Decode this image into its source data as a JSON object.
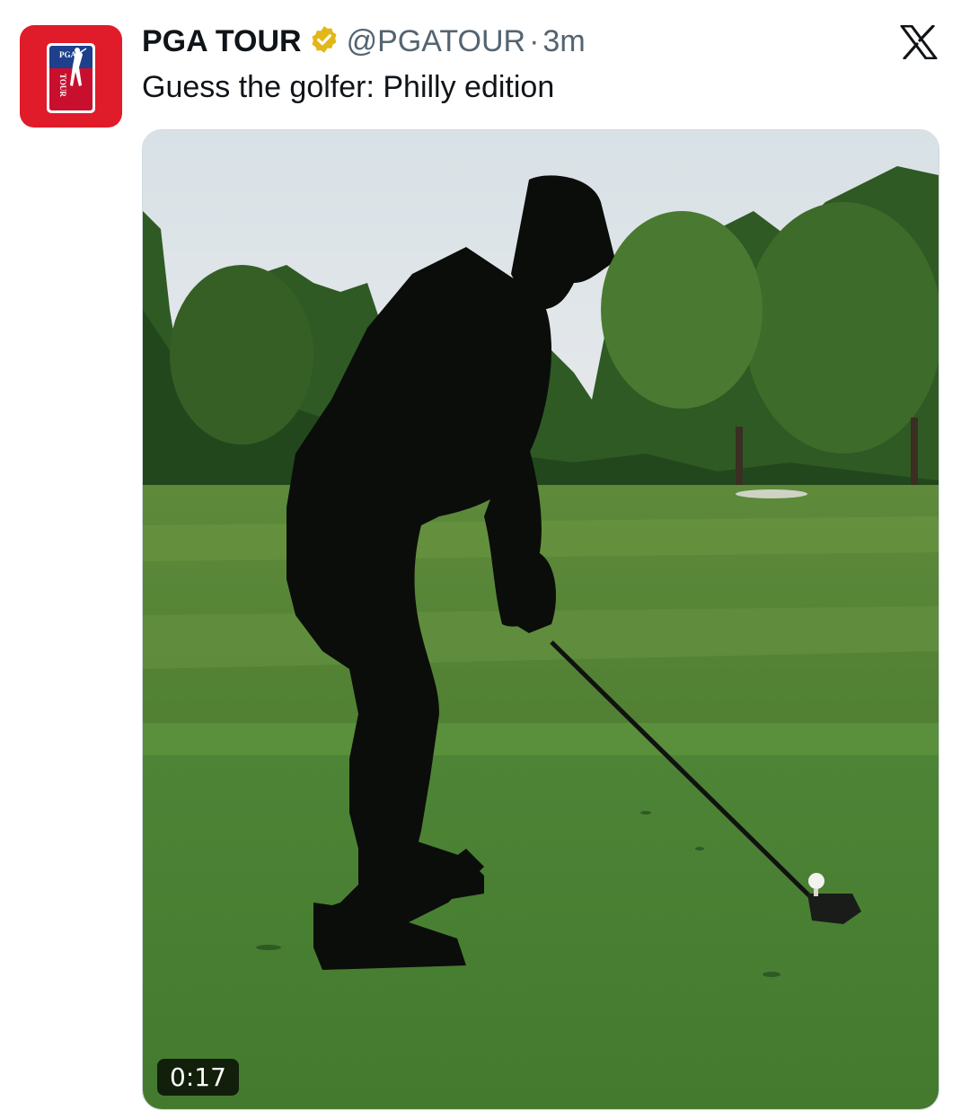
{
  "tweet": {
    "author": {
      "display_name": "PGA TOUR",
      "handle": "@PGATOUR",
      "verified": true,
      "avatar_logo_text_top": "PGA",
      "avatar_logo_text_bottom": "TOUR"
    },
    "separator": "·",
    "time": "3m",
    "text": "Guess the golfer: Philly edition",
    "media": {
      "type": "video",
      "duration": "0:17"
    }
  },
  "icons": {
    "verified": "verified-badge-icon",
    "platform": "x-logo-icon"
  },
  "colors": {
    "brand_red": "#e01b2a",
    "brand_blue": "#1d3f8c",
    "verified_gold": "#e2b719",
    "text_primary": "#0f1419",
    "text_secondary": "#536471"
  }
}
